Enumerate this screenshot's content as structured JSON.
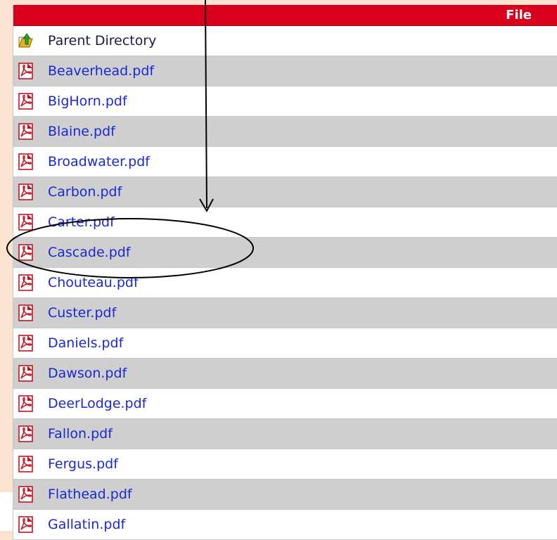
{
  "table": {
    "header": {
      "file_label": "File"
    },
    "rows": [
      {
        "name": "Parent Directory",
        "icon": "parent-folder-icon",
        "kind": "parent"
      },
      {
        "name": "Beaverhead.pdf",
        "icon": "pdf-icon"
      },
      {
        "name": "BigHorn.pdf",
        "icon": "pdf-icon"
      },
      {
        "name": "Blaine.pdf",
        "icon": "pdf-icon"
      },
      {
        "name": "Broadwater.pdf",
        "icon": "pdf-icon"
      },
      {
        "name": "Carbon.pdf",
        "icon": "pdf-icon"
      },
      {
        "name": "Carter.pdf",
        "icon": "pdf-icon"
      },
      {
        "name": "Cascade.pdf",
        "icon": "pdf-icon",
        "highlighted": true
      },
      {
        "name": "Chouteau.pdf",
        "icon": "pdf-icon"
      },
      {
        "name": "Custer.pdf",
        "icon": "pdf-icon"
      },
      {
        "name": "Daniels.pdf",
        "icon": "pdf-icon"
      },
      {
        "name": "Dawson.pdf",
        "icon": "pdf-icon"
      },
      {
        "name": "DeerLodge.pdf",
        "icon": "pdf-icon"
      },
      {
        "name": "Fallon.pdf",
        "icon": "pdf-icon"
      },
      {
        "name": "Fergus.pdf",
        "icon": "pdf-icon"
      },
      {
        "name": "Flathead.pdf",
        "icon": "pdf-icon"
      },
      {
        "name": "Gallatin.pdf",
        "icon": "pdf-icon"
      }
    ]
  },
  "annotation": {
    "highlighted_file": "Cascade.pdf"
  },
  "colors": {
    "header_bg": "#d9001b",
    "link": "#1a28d6",
    "alt_row": "#cfcfcf",
    "page_bg": "#fbe3cf"
  }
}
